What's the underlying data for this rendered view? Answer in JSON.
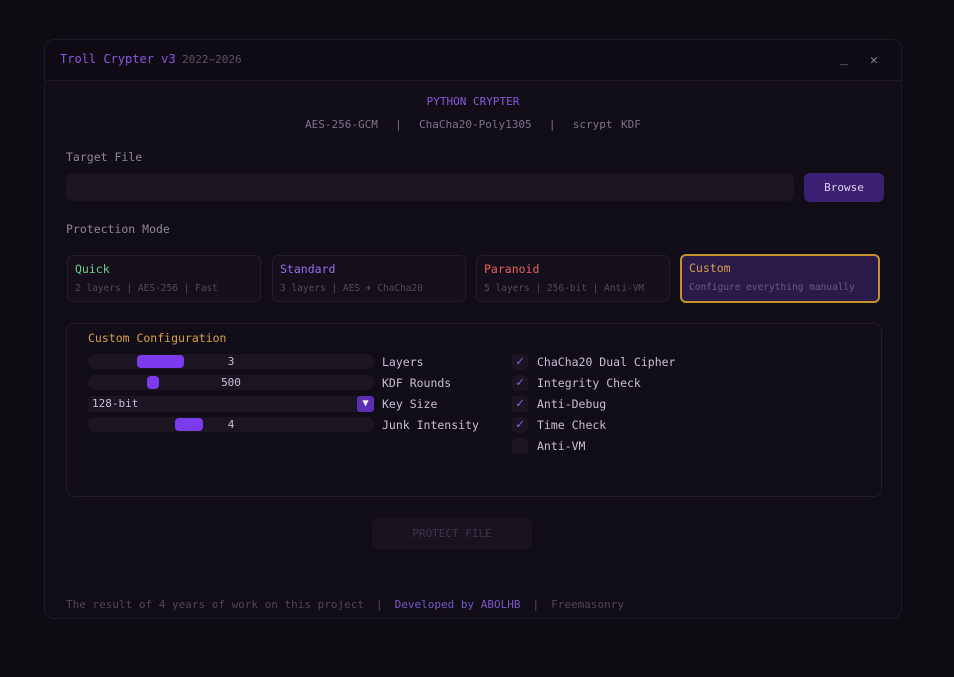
{
  "window": {
    "title": "Troll Crypter v3",
    "year": "2022~2026",
    "minimize": "_",
    "close": "✕"
  },
  "header": {
    "title": "PYTHON CRYPTER",
    "subtitle": "AES-256-GCM  |  ChaCha20-Poly1305  |  scrypt KDF"
  },
  "target": {
    "label": "Target File",
    "value": "",
    "placeholder": "",
    "browse_label": "Browse"
  },
  "mode": {
    "label": "Protection Mode",
    "options": [
      {
        "name": "Quick",
        "desc": "2 layers | AES-256 | Fast",
        "color": "#6fce8e"
      },
      {
        "name": "Standard",
        "desc": "3 layers | AES + ChaCha20",
        "color": "#9b6cf0"
      },
      {
        "name": "Paranoid",
        "desc": "5 layers | 256-bit | Anti-VM",
        "color": "#e8615f"
      },
      {
        "name": "Custom",
        "desc": "Configure everything manually",
        "color": "#d6a04a"
      }
    ],
    "selected": "Custom"
  },
  "config": {
    "title": "Custom Configuration",
    "layers": {
      "label": "Layers",
      "value": "3"
    },
    "kdf_rounds": {
      "label": "KDF Rounds",
      "value": "500"
    },
    "key_size": {
      "label": "Key Size",
      "value": "128-bit"
    },
    "junk": {
      "label": "Junk Intensity",
      "value": "4"
    },
    "options": [
      {
        "label": "ChaCha20 Dual Cipher",
        "checked": true
      },
      {
        "label": "Integrity Check",
        "checked": true
      },
      {
        "label": "Anti-Debug",
        "checked": true
      },
      {
        "label": "Time Check",
        "checked": true
      },
      {
        "label": "Anti-VM",
        "checked": false
      }
    ]
  },
  "protect_label": "PROTECT FILE",
  "footer": {
    "part1": "The result of 4 years of work on this project",
    "sep": "|",
    "part2": "Developed by ABOLHB",
    "part3": "Freemasonry"
  },
  "colors": {
    "accent": "#7c3aed",
    "gold": "#d6a04a"
  }
}
